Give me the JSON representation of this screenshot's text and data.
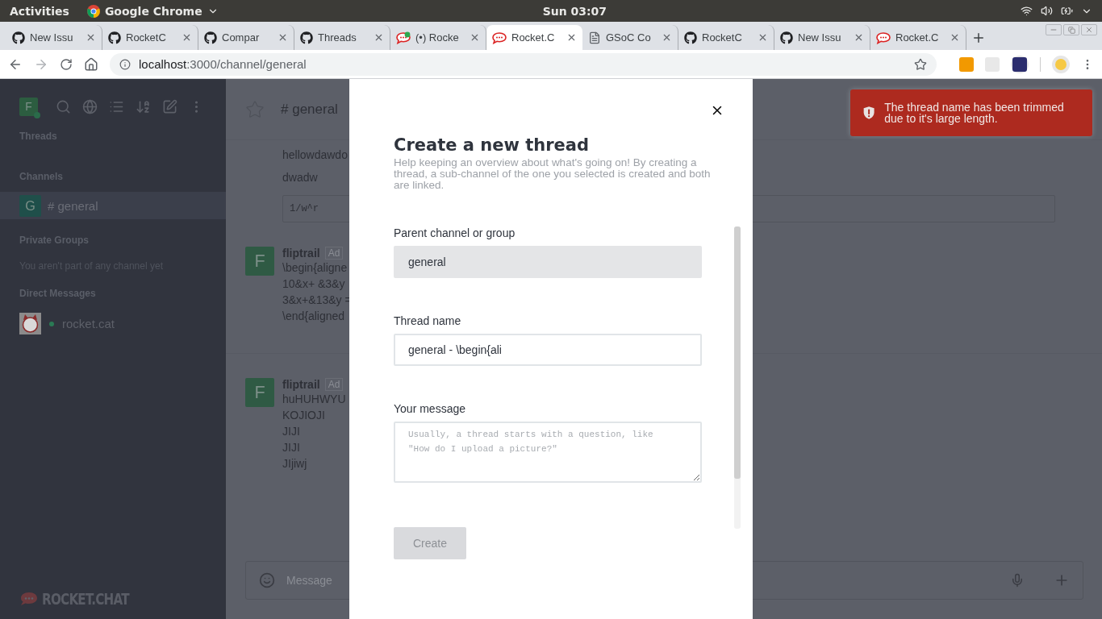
{
  "system_bar": {
    "activities": "Activities",
    "app": "Google Chrome",
    "clock": "Sun 03:07"
  },
  "browser": {
    "tabs": [
      {
        "kind": "github",
        "title": "New Issu",
        "selected": false
      },
      {
        "kind": "github",
        "title": "RocketC",
        "selected": false
      },
      {
        "kind": "github",
        "title": "Compar",
        "selected": false
      },
      {
        "kind": "github",
        "title": "Threads",
        "selected": false
      },
      {
        "kind": "rocket-alert",
        "title": "(•) Rocke",
        "selected": false
      },
      {
        "kind": "rocket",
        "title": "Rocket.C",
        "selected": true
      },
      {
        "kind": "doc",
        "title": "GSoC Co",
        "selected": false
      },
      {
        "kind": "github",
        "title": "RocketC",
        "selected": false
      },
      {
        "kind": "github",
        "title": "New Issu",
        "selected": false
      },
      {
        "kind": "rocket",
        "title": "Rocket.C",
        "selected": false
      }
    ],
    "url_host": "localhost",
    "url_path": ":3000/channel/general"
  },
  "sidebar": {
    "avatar": "F",
    "threads_header": "Threads",
    "channels_header": "Channels",
    "channels": [
      {
        "avatar": "G",
        "name": "# general",
        "selected": true
      }
    ],
    "private_groups": {
      "header": "Private Groups",
      "empty": "You aren't part of any channel yet"
    },
    "direct_messages": {
      "header": "Direct Messages",
      "items": [
        {
          "name": "rocket.cat",
          "online": true
        }
      ]
    },
    "logo": "ROCKET.CHAT"
  },
  "main": {
    "channel": "# general",
    "messages": [
      {
        "kind": "text",
        "text": "hellowdawdo"
      },
      {
        "kind": "text",
        "text": "dwadw"
      },
      {
        "kind": "code",
        "text": "1/w^r"
      }
    ],
    "posts": [
      {
        "avatar": "F",
        "author": "fliptrail",
        "badge": "Ad",
        "lines": [
          "\\begin{aligne",
          "10&x+ &3&y",
          "3&x+&13&y =",
          "\\end{aligned"
        ]
      },
      {
        "avatar": "F",
        "author": "fliptrail",
        "badge": "Ad",
        "lines": [
          "huHUHWYU",
          "KOJIOJI",
          "JIJI",
          "JIJI",
          "JIjiwj"
        ]
      }
    ],
    "composer": {
      "placeholder": "Message"
    }
  },
  "modal": {
    "title": "Create a new thread",
    "description": "Help keeping an overview about what's going on! By creating a thread, a sub-channel of the one you selected is created and both are linked.",
    "fields": [
      {
        "kind": "select",
        "label": "Parent channel or group",
        "value": "general"
      },
      {
        "kind": "input",
        "label": "Thread name",
        "value": "general - \\begin{ali"
      },
      {
        "kind": "textarea",
        "label": "Your message",
        "placeholder": "Usually, a thread starts with a question, like\n\n\"How do I upload a picture?\""
      }
    ],
    "button": {
      "label": "Create",
      "disabled": true
    }
  },
  "toast": {
    "text": "The thread name has been trimmed due to it's large length."
  }
}
